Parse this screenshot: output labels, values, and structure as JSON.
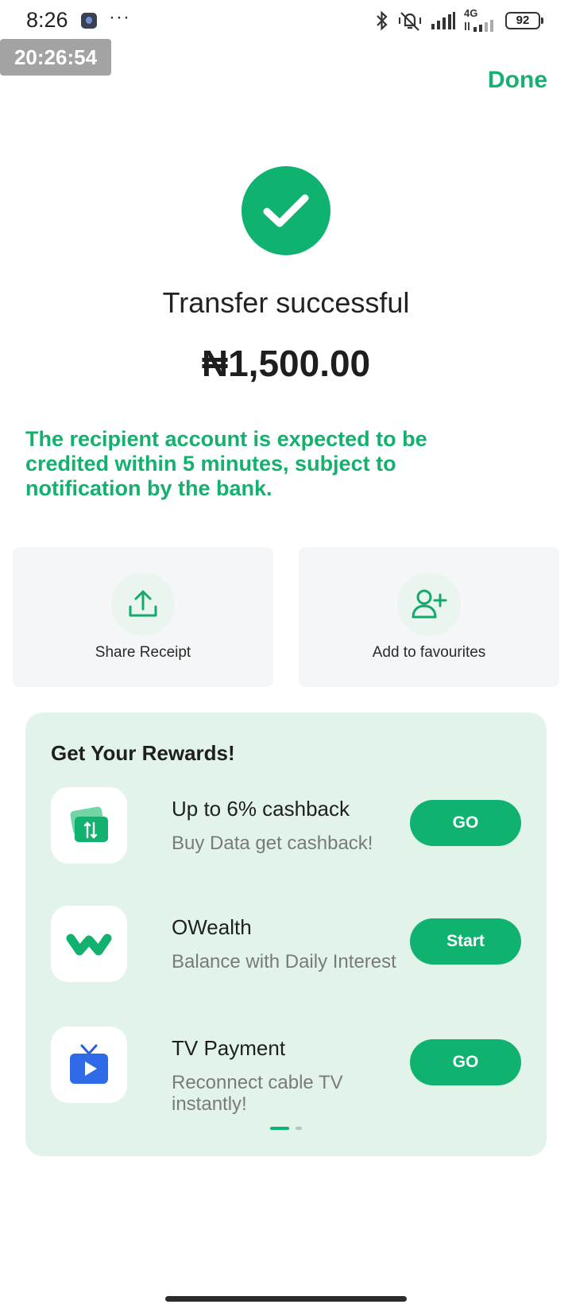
{
  "status_bar": {
    "time": "8:26",
    "dots": "···",
    "network_label": "4G",
    "battery": "92"
  },
  "overlay_time": "20:26:54",
  "header": {
    "done_label": "Done"
  },
  "result": {
    "title": "Transfer successful",
    "amount": "₦1,500.00",
    "note": "The recipient account is expected to be credited within 5 minutes, subject to notification by the bank."
  },
  "actions": [
    {
      "label": "Share Receipt",
      "icon": "share-upload-icon"
    },
    {
      "label": "Add to favourites",
      "icon": "add-user-icon"
    }
  ],
  "rewards": {
    "title": "Get Your Rewards!",
    "items": [
      {
        "title": "Up to 6% cashback",
        "subtitle": "Buy Data get cashback!",
        "button": "GO",
        "icon": "data-card-icon"
      },
      {
        "title": "OWealth",
        "subtitle": "Balance with Daily Interest",
        "button": "Start",
        "icon": "owealth-logo-icon"
      },
      {
        "title": "TV Payment",
        "subtitle": "Reconnect cable TV instantly!",
        "button": "GO",
        "icon": "tv-play-icon"
      }
    ],
    "page_index": 1,
    "page_count": 2
  },
  "colors": {
    "accent": "#10b26f",
    "rewards_bg": "#e2f4ea",
    "card_bg": "#f5f6f8"
  }
}
